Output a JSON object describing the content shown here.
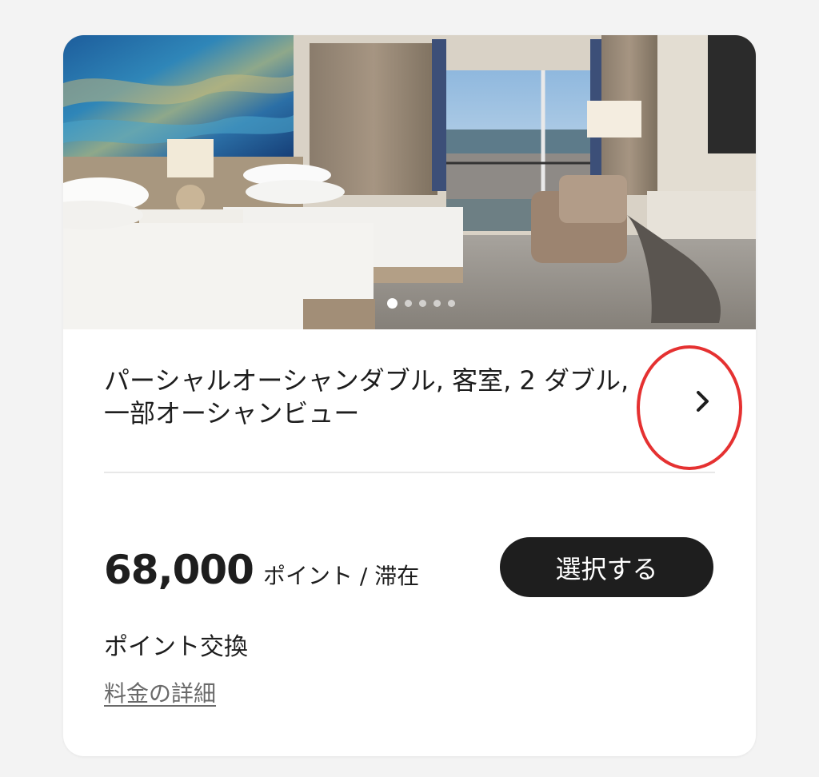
{
  "room_card": {
    "photo": {
      "description_icon": "hotel-room-photo",
      "slide_count": 5,
      "active_slide": 1
    },
    "title": "パーシャルオーシャンダブル, 客室, 2 ダブル, 一部オーシャンビュー",
    "details_chevron_icon": "chevron-right-icon",
    "price": {
      "value": "68,000",
      "unit": "ポイント / 滞在"
    },
    "select_button_label": "選択する",
    "rate_type": "ポイント交換",
    "rate_details_link": "料金の詳細"
  },
  "colors": {
    "button_bg": "#1e1e1e",
    "annotation_red": "#e53131",
    "link_gray": "#6a6a6a"
  }
}
